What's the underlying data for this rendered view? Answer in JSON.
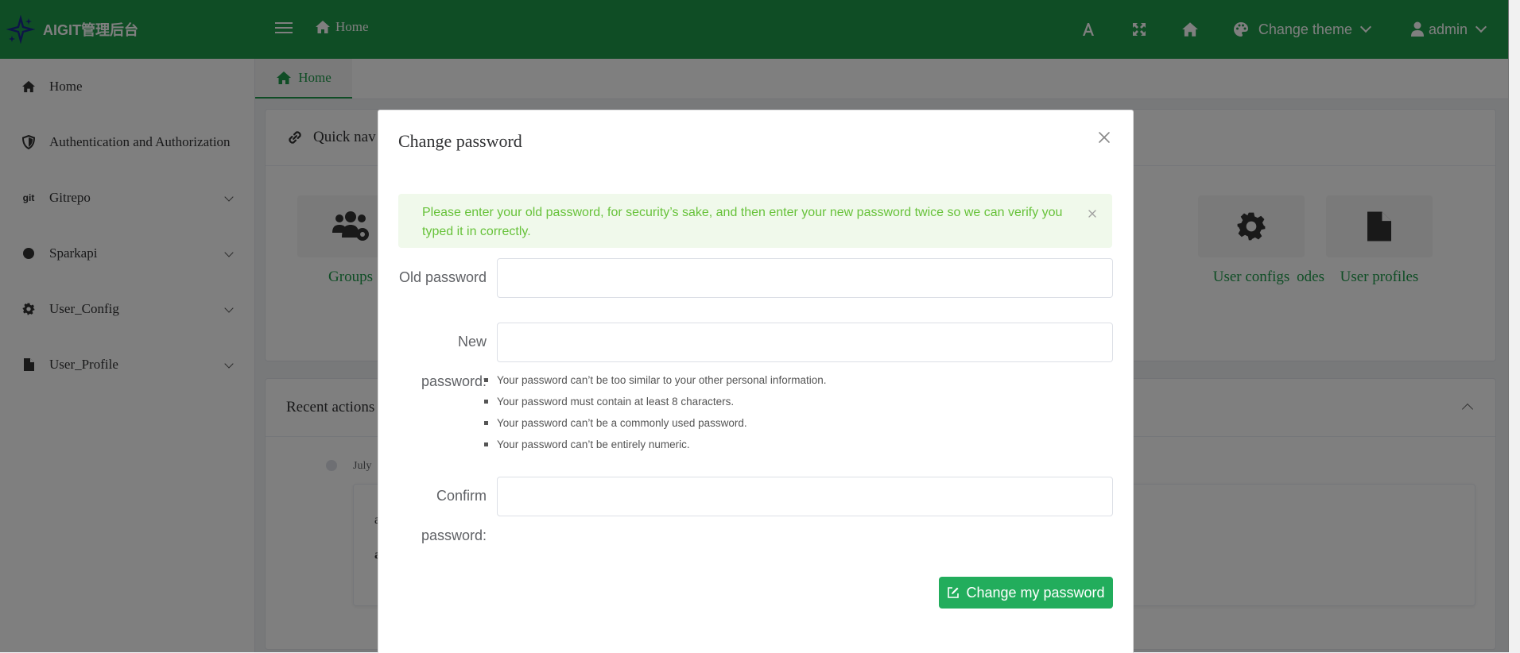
{
  "app": {
    "title": "AIGIT管理后台",
    "brand_color": "#1e9b4a"
  },
  "header": {
    "breadcrumb": "Home",
    "theme_label": "Change theme",
    "user_label": "admin",
    "icons": [
      "font-size-icon",
      "fullscreen-icon",
      "home-icon",
      "palette-icon",
      "user-icon"
    ]
  },
  "sidebar": {
    "items": [
      {
        "label": "Home",
        "icon": "home-icon"
      },
      {
        "label": "Authentication and Authorization",
        "icon": "shield-icon"
      },
      {
        "label": "Gitrepo",
        "icon": "git-icon"
      },
      {
        "label": "Sparkapi",
        "icon": "circle-icon"
      },
      {
        "label": "User_Config",
        "icon": "gear-icon"
      },
      {
        "label": "User_Profile",
        "icon": "file-icon"
      }
    ]
  },
  "tabs": [
    {
      "label": "Home"
    }
  ],
  "quick_nav": {
    "title": "Quick nav",
    "tiles": [
      {
        "label": "Groups",
        "icon": "users-cog-icon"
      },
      {
        "label": "odes",
        "icon": "codes-icon"
      },
      {
        "label": "User configs",
        "icon": "gear-icon"
      },
      {
        "label": "User profiles",
        "icon": "file-icon"
      }
    ]
  },
  "recent_actions": {
    "title": "Recent actions",
    "date": "July",
    "entry_letters": [
      "a",
      "a"
    ]
  },
  "modal": {
    "title": "Change password",
    "alert": "Please enter your old password, for security’s sake, and then enter your new password twice so we can verify you typed it in correctly.",
    "old_password_label": "Old password",
    "new_password_label_1": "New",
    "new_password_label_2": "password:",
    "confirm_label_1": "Confirm",
    "confirm_label_2": "password:",
    "old_password_value": "",
    "new_password_value": "",
    "confirm_value": "",
    "help": [
      "Your password can’t be too similar to your other personal information.",
      "Your password must contain at least 8 characters.",
      "Your password can’t be a commonly used password.",
      "Your password can’t be entirely numeric."
    ],
    "submit_label": "Change my password",
    "submit_color": "#22ad5c",
    "alert_text_color": "#67c23a"
  }
}
